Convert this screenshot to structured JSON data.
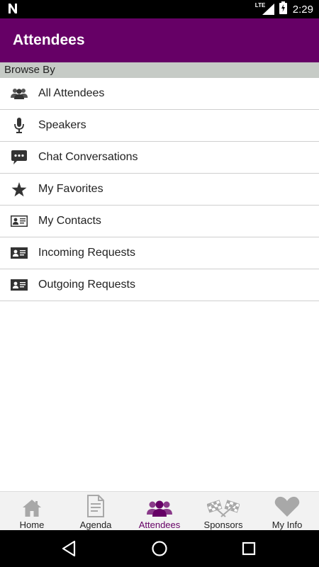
{
  "status_bar": {
    "time": "2:29",
    "network": "LTE",
    "icons": [
      "n-notification-icon",
      "lte-signal-icon",
      "battery-charging-icon"
    ]
  },
  "app_bar": {
    "title": "Attendees",
    "color": "#660066"
  },
  "section": {
    "header": "Browse By"
  },
  "menu": {
    "items": [
      {
        "label": "All Attendees",
        "icon": "people-icon"
      },
      {
        "label": "Speakers",
        "icon": "microphone-icon"
      },
      {
        "label": "Chat Conversations",
        "icon": "chat-bubble-icon"
      },
      {
        "label": "My Favorites",
        "icon": "star-icon"
      },
      {
        "label": "My Contacts",
        "icon": "contact-card-icon"
      },
      {
        "label": "Incoming Requests",
        "icon": "id-card-icon"
      },
      {
        "label": "Outgoing Requests",
        "icon": "id-card-icon"
      }
    ]
  },
  "tabs": {
    "items": [
      {
        "label": "Home",
        "icon": "home-icon"
      },
      {
        "label": "Agenda",
        "icon": "document-icon"
      },
      {
        "label": "Attendees",
        "icon": "people-icon"
      },
      {
        "label": "Sponsors",
        "icon": "checkered-flags-icon"
      },
      {
        "label": "My Info",
        "icon": "heart-icon"
      }
    ],
    "active": "Attendees",
    "active_color": "#660066",
    "inactive_icon_color": "#a8a8a8"
  },
  "nav_bar": {
    "buttons": [
      "back-icon",
      "home-circle-icon",
      "recents-square-icon"
    ]
  }
}
